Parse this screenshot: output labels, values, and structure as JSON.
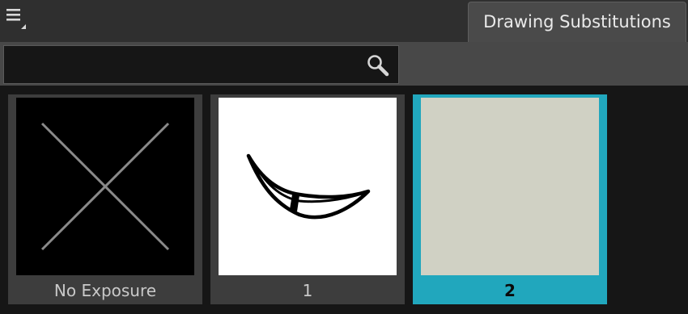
{
  "toolbar": {
    "menu_icon": "hamburger-menu-icon",
    "tab_label": "Drawing Substitutions"
  },
  "search": {
    "value": "",
    "placeholder": "",
    "icon": "magnifier-icon"
  },
  "thumbnails": [
    {
      "label": "No Exposure",
      "preview": "empty-x-icon",
      "selected": false
    },
    {
      "label": "1",
      "preview": "smile-drawing",
      "selected": false
    },
    {
      "label": "2",
      "preview": "blank-drawing",
      "selected": true
    }
  ],
  "colors": {
    "selection": "#21a7bd",
    "tile": "#3d3d3d",
    "background": "#161616",
    "blank_drawing": "#d0d1c4"
  }
}
